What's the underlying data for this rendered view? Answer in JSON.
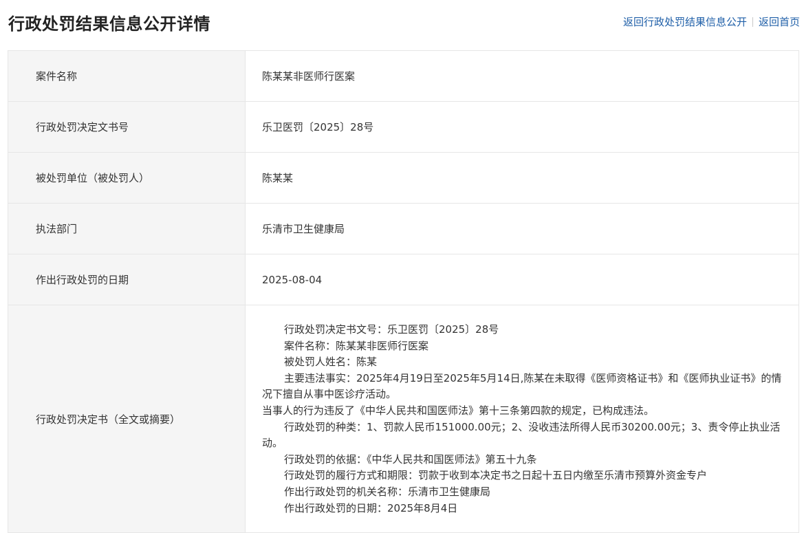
{
  "header": {
    "title": "行政处罚结果信息公开详情",
    "nav": {
      "back_to_list": "返回行政处罚结果信息公开",
      "back_home": "返回首页"
    }
  },
  "details": {
    "case_name": {
      "label": "案件名称",
      "value": "陈某某非医师行医案"
    },
    "decision_no": {
      "label": "行政处罚决定文书号",
      "value": "乐卫医罚〔2025〕28号"
    },
    "penalized_party": {
      "label": "被处罚单位（被处罚人）",
      "value": "陈某某"
    },
    "enforcement_dept": {
      "label": "执法部门",
      "value": "乐清市卫生健康局"
    },
    "decision_date": {
      "label": "作出行政处罚的日期",
      "value": "2025-08-04"
    },
    "full_text": {
      "label": "行政处罚决定书（全文或摘要）",
      "lines": [
        "行政处罚决定书文号：乐卫医罚〔2025〕28号",
        "案件名称：陈某某非医师行医案",
        "被处罚人姓名：陈某",
        "主要违法事实：2025年4月19日至2025年5月14日,陈某在未取得《医师资格证书》和《医师执业证书》的情况下擅自从事中医诊疗活动。",
        "当事人的行为违反了《中华人民共和国医师法》第十三条第四款的规定，已构成违法。",
        "行政处罚的种类：1、罚款人民币151000.00元；2、没收违法所得人民币30200.00元；3、责令停止执业活动。",
        "行政处罚的依据：《中华人民共和国医师法》第五十九条",
        "行政处罚的履行方式和期限：罚款于收到本决定书之日起十五日内缴至乐清市预算外资金专户",
        "作出行政处罚的机关名称：乐清市卫生健康局",
        "作出行政处罚的日期：2025年8月4日"
      ]
    }
  }
}
